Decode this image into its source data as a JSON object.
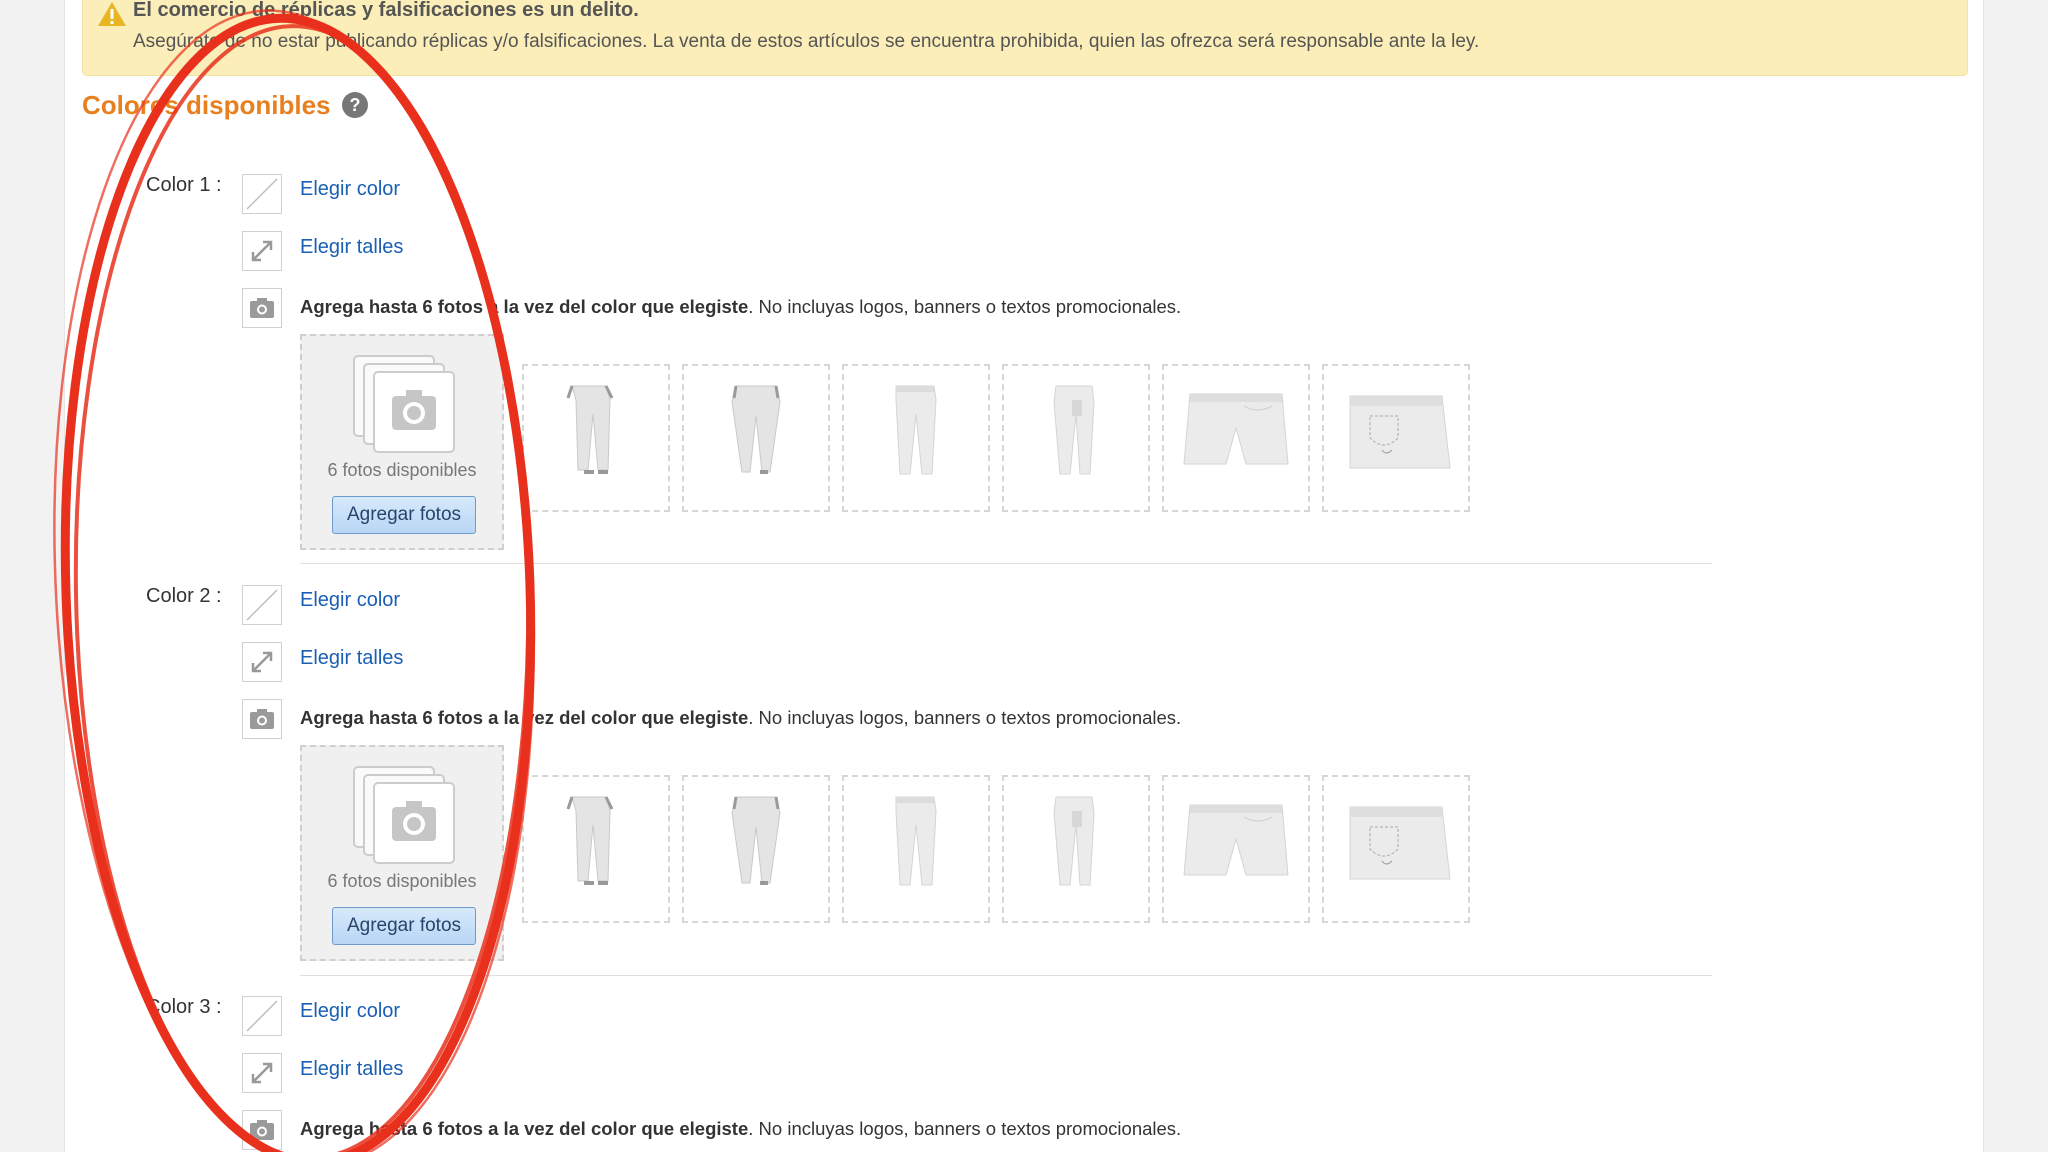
{
  "alert": {
    "title": "El comercio de réplicas y falsificaciones es un delito.",
    "body": "Asegúrate de no estar publicando réplicas y/o falsificaciones. La venta de estos artículos se encuentra prohibida, quien las ofrezca será responsable ante la ley.",
    "icon": "warning-icon"
  },
  "section": {
    "title": "Colores disponibles",
    "help": "?"
  },
  "colors": [
    {
      "label": "Color 1 :",
      "choose_color": "Elegir color",
      "choose_sizes": "Elegir talles",
      "instructions_bold": "Agrega hasta 6 fotos a la vez del color que elegiste",
      "instructions_rest": ". No incluyas logos, banners o textos promocionales.",
      "photos_available": "6 fotos disponibles",
      "add_photos": "Agregar fotos"
    },
    {
      "label": "Color 2 :",
      "choose_color": "Elegir color",
      "choose_sizes": "Elegir talles",
      "instructions_bold": "Agrega hasta 6 fotos a la vez del color que elegiste",
      "instructions_rest": ". No incluyas logos, banners o textos promocionales.",
      "photos_available": "6 fotos disponibles",
      "add_photos": "Agregar fotos"
    },
    {
      "label": "Color 3 :",
      "choose_color": "Elegir color",
      "choose_sizes": "Elegir talles",
      "instructions_bold": "Agrega hasta 6 fotos a la vez del color que elegiste",
      "instructions_rest": ". No incluyas logos, banners o textos promocionales."
    }
  ],
  "photo_slots": [
    "pants-front-icon",
    "pants-back-icon",
    "pants-side-icon",
    "pants-side2-icon",
    "shorts-front-icon",
    "shorts-back-icon"
  ],
  "colors_meta": {
    "accent": "#e8801f",
    "link": "#1a5fb4",
    "annotation": "#e8301c"
  }
}
